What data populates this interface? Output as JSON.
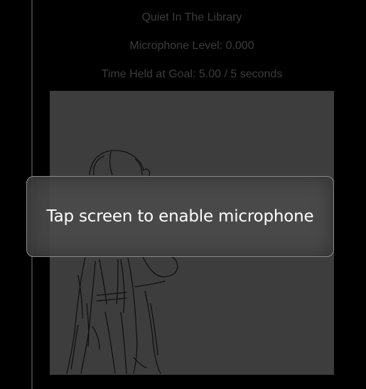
{
  "game": {
    "title": "Quiet In The Library",
    "mic_level_text": "Microphone Level: 0.000",
    "time_held_text": "Time Held at Goal: 5.00 / 5 seconds"
  },
  "overlay": {
    "prompt": "Tap screen to enable microphone"
  },
  "colors": {
    "page_background": "#000000",
    "canvas_background": "#3d3d3d",
    "info_text": "#3c3c3c",
    "overlay_background": "#4a4a4a",
    "overlay_border": "#8a8a8a",
    "overlay_text": "#ffffff"
  }
}
